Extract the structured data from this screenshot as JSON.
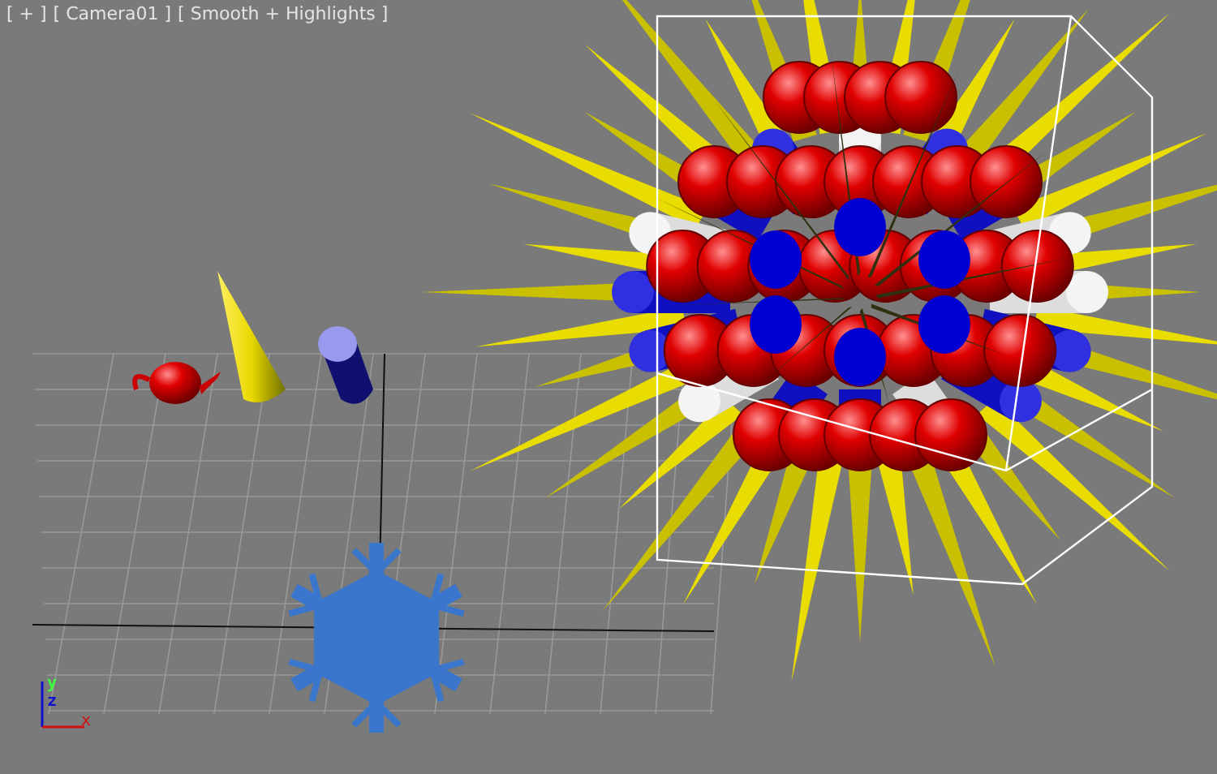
{
  "viewport": {
    "labels": [
      "[ + ]",
      "[ Camera01 ]",
      "[ Smooth + Highlights ]"
    ]
  },
  "axis_gizmo": {
    "y": "y",
    "z": "z",
    "x": "x"
  }
}
